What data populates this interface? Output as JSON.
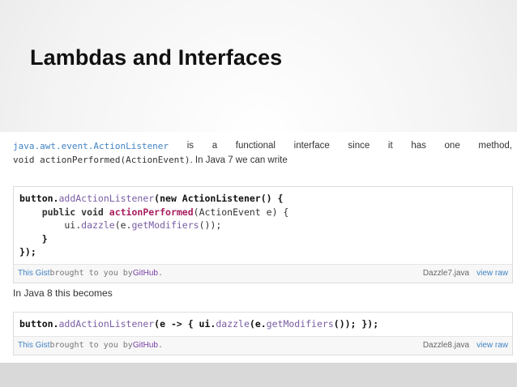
{
  "slide": {
    "title": "Lambdas and Interfaces"
  },
  "intro": {
    "line1_words": [
      "java.awt.event.ActionListener",
      "is",
      "a",
      "functional",
      "interface",
      "since",
      "it",
      "has",
      "one",
      "method,"
    ],
    "line2_code": "void actionPerformed(ActionEvent)",
    "line2_text": ". In Java 7 we can write"
  },
  "gist1": {
    "code": {
      "l1_a": "button.",
      "l1_b": "addActionListener",
      "l1_c": "(new ActionListener() {",
      "l2_a": "    public void ",
      "l2_b": "actionPerformed",
      "l2_c": "(ActionEvent e) {",
      "l3_a": "        ui.",
      "l3_b": "dazzle",
      "l3_c": "(e.",
      "l3_d": "getModifiers",
      "l3_e": "());",
      "l4": "    }",
      "l5": "});"
    },
    "meta": {
      "this_gist": "This Gist",
      "brought": " brought to you by ",
      "github": "GitHub",
      "dot": ".",
      "filename": "Dazzle7.java",
      "view_raw": "view raw"
    }
  },
  "middle_text": "In Java 8 this becomes",
  "gist2": {
    "code": {
      "a": "button.",
      "b": "addActionListener",
      "c": "(e -> { ui.",
      "d": "dazzle",
      "e": "(e.",
      "f": "getModifiers",
      "g": "()); });"
    },
    "meta": {
      "this_gist": "This Gist",
      "brought": " brought to you by ",
      "github": "GitHub",
      "dot": ".",
      "filename": "Dazzle8.java",
      "view_raw": "view raw"
    }
  }
}
